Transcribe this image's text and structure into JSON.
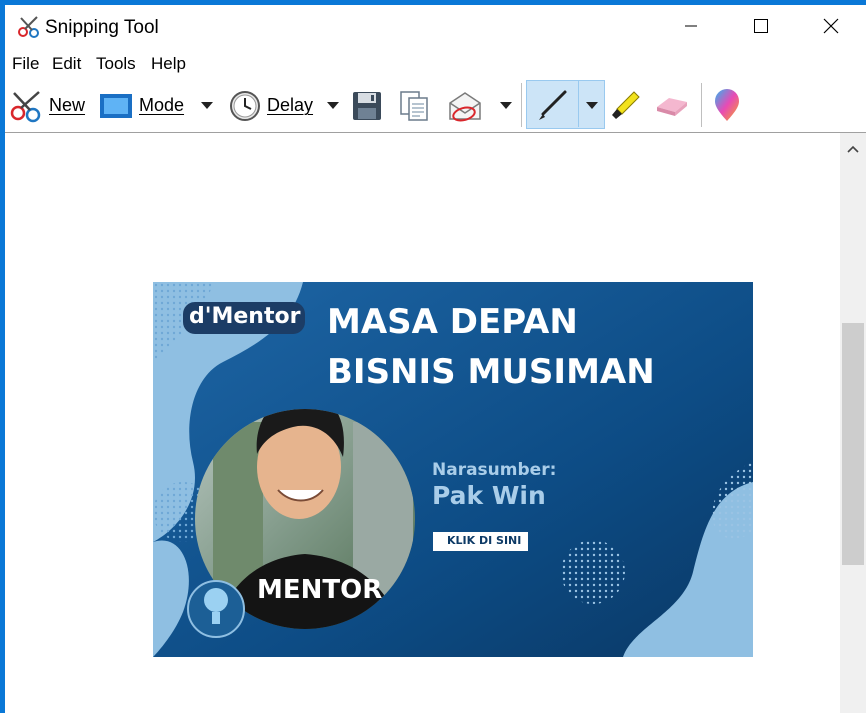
{
  "window": {
    "title": "Snipping Tool",
    "icon": "scissors-icon",
    "controls": [
      "minimize-icon",
      "maximize-icon",
      "close-icon"
    ]
  },
  "menu": {
    "file": "File",
    "edit": "Edit",
    "tools": "Tools",
    "help": "Help"
  },
  "toolbar": {
    "new_label": "New",
    "mode_label": "Mode",
    "delay_label": "Delay",
    "icons": [
      "scissors-icon",
      "mode-rectangle-icon",
      "clock-icon",
      "save-icon",
      "copy-icon",
      "send-email-icon",
      "pen-icon",
      "highlighter-icon",
      "eraser-icon",
      "paint3d-icon"
    ],
    "active_tool": "pen"
  },
  "snip": {
    "brand": "d'Mentor",
    "headline_line1": "MASA DEPAN",
    "headline_line2": "BISNIS MUSIMAN",
    "speaker_label": "Narasumber:",
    "speaker_name": "Pak Win",
    "cta": "KLIK DI SINI",
    "shirt_text": "MENTOR",
    "colors": {
      "background": "#0f4f86",
      "light_blue": "#8fbfe2",
      "brand_bg": "#1c3d66"
    }
  }
}
